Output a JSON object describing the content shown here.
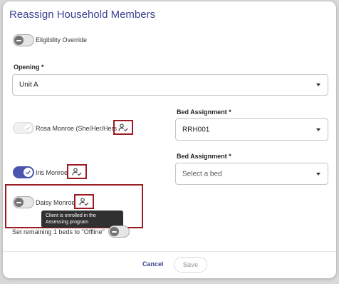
{
  "dialog": {
    "title": "Reassign Household Members",
    "eligibility_override": {
      "label": "Eligibility Override",
      "checked": false
    },
    "opening": {
      "label": "Opening *",
      "value": "Unit A"
    },
    "members": [
      {
        "name": "Rosa Monroe (She/Her/Hers",
        "toggle": "on-disabled",
        "bed_label": "Bed Assignment *",
        "bed_value": "RRH001"
      },
      {
        "name": "Iris Monroe",
        "toggle": "on",
        "bed_label": "Bed Assignment *",
        "bed_placeholder": "Select a bed"
      },
      {
        "name": "Daisy Monroe",
        "toggle": "off",
        "tooltip": "Client is enrolled in the Assessing program"
      }
    ],
    "offline": {
      "label": "Set remaining 1 beds to \"Offline\"",
      "checked": false
    },
    "actions": {
      "cancel": "Cancel",
      "save": "Save"
    }
  },
  "icons": {
    "enrolled": "person-check-icon",
    "dropdown": "caret-down-icon",
    "check": "check-icon"
  },
  "colors": {
    "primary": "#4a55b0",
    "title": "#3d4290",
    "highlight": "#9b1b22",
    "tooltip_bg": "#303030"
  }
}
